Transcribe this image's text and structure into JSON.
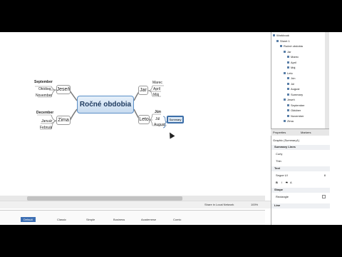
{
  "mindmap": {
    "central": "Ročné obdobia",
    "branches": {
      "jesen": {
        "label": "Jeseň",
        "month_above": "September",
        "months": [
          "Október",
          "November"
        ]
      },
      "zima": {
        "label": "Zima",
        "month_above": "December",
        "months": [
          "Január",
          "Február"
        ]
      },
      "jar": {
        "label": "Jar",
        "month_above": "Marec",
        "months": [
          "Apríl",
          "Máj"
        ]
      },
      "leto": {
        "label": "Leto",
        "month_above": "Jún",
        "months": [
          "Júl",
          "August"
        ]
      }
    },
    "summary_label": "Summary"
  },
  "outline": {
    "items": [
      {
        "label": "Workbook",
        "level": 0
      },
      {
        "label": "Sheet 1",
        "level": 1
      },
      {
        "label": "Ročné obdobia",
        "level": 2
      },
      {
        "label": "Jar",
        "level": 3
      },
      {
        "label": "Marec",
        "level": 4
      },
      {
        "label": "Apríl",
        "level": 4
      },
      {
        "label": "Máj",
        "level": 4
      },
      {
        "label": "Leto",
        "level": 3
      },
      {
        "label": "Jún",
        "level": 4
      },
      {
        "label": "Júl",
        "level": 4
      },
      {
        "label": "August",
        "level": 4
      },
      {
        "label": "Summary",
        "level": 4
      },
      {
        "label": "Jeseň",
        "level": 3
      },
      {
        "label": "September",
        "level": 4
      },
      {
        "label": "Október",
        "level": 4
      },
      {
        "label": "November",
        "level": 4
      },
      {
        "label": "Zima",
        "level": 3
      }
    ]
  },
  "panel_tabs": {
    "properties": "Properties",
    "markers": "Markers"
  },
  "properties": {
    "title": "Graphic (Summary1)",
    "summary_lines_header": "Summary Lines",
    "curly": "Curly",
    "thin": "Thin",
    "text_header": "Text",
    "font_name": "Segoe UI",
    "font_size": "8",
    "shape_header": "Shape",
    "shape_value": "Rectangle",
    "line_header": "Line"
  },
  "status": {
    "shared": "Share in Local Network",
    "zoom": "100%"
  },
  "themes": [
    "Default",
    "Classic",
    "Simple",
    "Business",
    "Academese",
    "Comic"
  ],
  "colors": {
    "accent": "#3d6fb3",
    "central_border": "#5b8fc7",
    "summary_border": "#3c6ea8"
  }
}
